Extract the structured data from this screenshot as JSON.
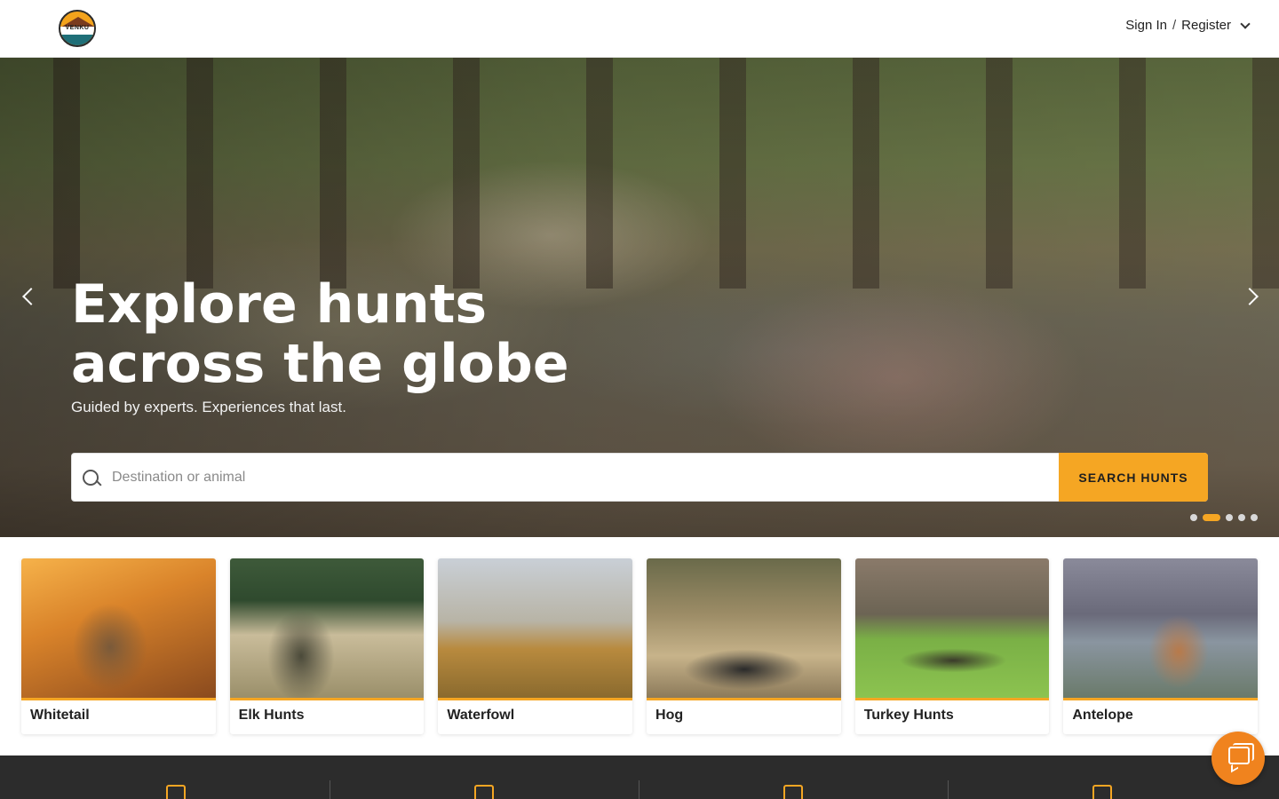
{
  "header": {
    "logo_text": "VENKU",
    "sign_in_label": "Sign In",
    "separator": "/",
    "register_label": "Register"
  },
  "hero": {
    "title_line1": "Explore hunts",
    "title_line2": "across the globe",
    "subtitle": "Guided by experts. Experiences that last.",
    "search": {
      "placeholder": "Destination or animal",
      "value": "",
      "button_label": "SEARCH HUNTS"
    },
    "slides_total": 5,
    "active_slide": 2
  },
  "categories": [
    {
      "label": "Whitetail"
    },
    {
      "label": "Elk Hunts"
    },
    {
      "label": "Waterfowl"
    },
    {
      "label": "Hog"
    },
    {
      "label": "Turkey Hunts"
    },
    {
      "label": "Antelope"
    }
  ],
  "colors": {
    "accent": "#f5a623",
    "chat": "#f0831e",
    "footer": "#2c2c2c"
  }
}
